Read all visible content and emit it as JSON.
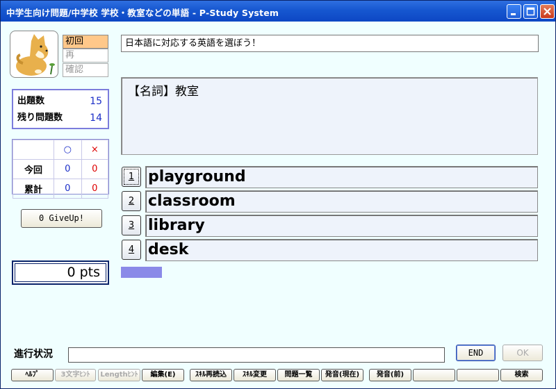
{
  "window": {
    "title": "中学生向け問題/中学校 学校・教室などの単語 - P-Study System"
  },
  "mascot": {
    "icon": "shiba-dog-icon"
  },
  "modes": [
    {
      "label": "初回",
      "active": true
    },
    {
      "label": "再",
      "active": false
    },
    {
      "label": "確認",
      "active": false
    }
  ],
  "counts": {
    "total_label": "出題数",
    "total_value": "15",
    "remaining_label": "残り問題数",
    "remaining_value": "14"
  },
  "score": {
    "correct_symbol": "○",
    "wrong_symbol": "×",
    "current_label": "今回",
    "current_correct": "0",
    "current_wrong": "0",
    "cumulative_label": "累計",
    "cumulative_correct": "0",
    "cumulative_wrong": "0"
  },
  "giveup_label": "0 GiveUp!",
  "points": "0 pts",
  "instruction": "日本語に対応する英語を選ぼう！",
  "question": "【名詞】教室",
  "choices": [
    {
      "num": "1",
      "text": "playground"
    },
    {
      "num": "2",
      "text": "classroom"
    },
    {
      "num": "3",
      "text": "library"
    },
    {
      "num": "4",
      "text": "desk"
    }
  ],
  "progress_fraction": 0.1,
  "status": {
    "label": "進行状況",
    "value": "",
    "end_label": "END",
    "ok_label": "OK"
  },
  "toolbar": [
    {
      "label": "ﾍﾙﾌﾟ",
      "enabled": true
    },
    {
      "label": "3文字ﾋﾝﾄ",
      "enabled": false
    },
    {
      "label": "Lengthﾋﾝﾄ",
      "enabled": false
    },
    {
      "label": "編集(E)",
      "enabled": true
    },
    {
      "label": "ｽｷﾙ再読込",
      "enabled": true
    },
    {
      "label": "ｽｷﾙ変更",
      "enabled": true
    },
    {
      "label": "問題一覧",
      "enabled": true
    },
    {
      "label": "発音(現在)",
      "enabled": true
    },
    {
      "label": "発音(前)",
      "enabled": true
    },
    {
      "label": "",
      "enabled": true
    },
    {
      "label": "",
      "enabled": true
    },
    {
      "label": "検索",
      "enabled": true
    }
  ],
  "colors": {
    "titlebar": "#1657d0",
    "active_mode": "#ffc88a",
    "progress": "#8a8ae8",
    "count_value": "#1b2ec8",
    "wrong_value": "#dd0000"
  }
}
